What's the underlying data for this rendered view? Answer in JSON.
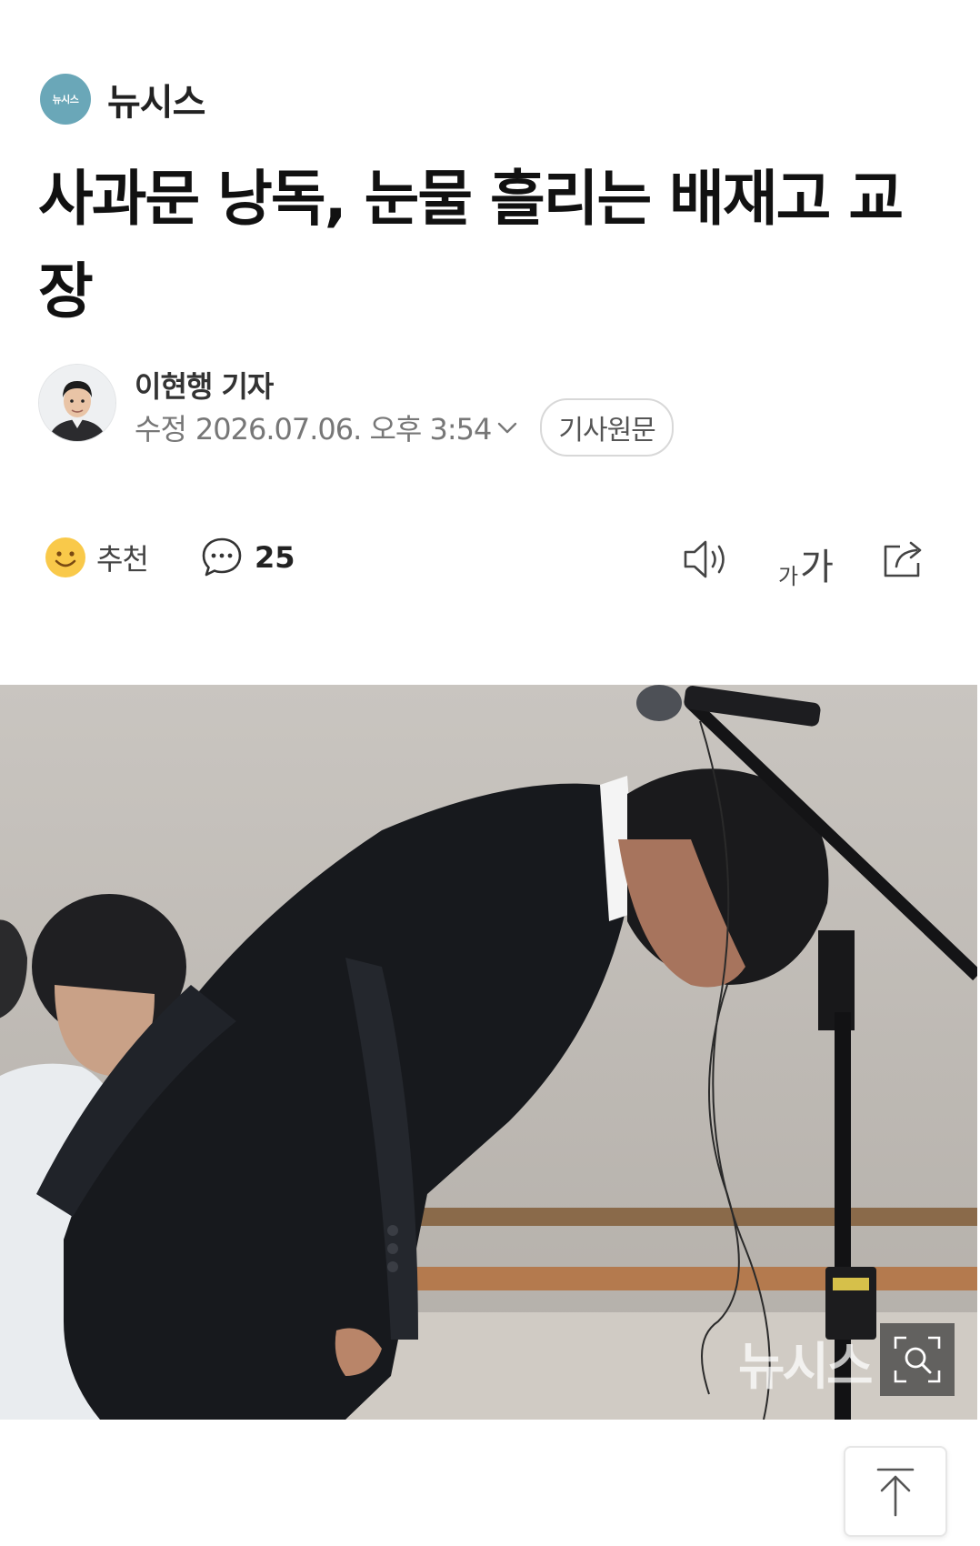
{
  "press": {
    "logo_text": "뉴시스",
    "name": "뉴시스"
  },
  "article": {
    "headline": "사과문 낭독, 눈물 흘리는 배재고 교장"
  },
  "byline": {
    "reporter": "이현행 기자",
    "modified_label": "수정",
    "timestamp": "2026.07.06. 오후 3:54",
    "original_button": "기사원문"
  },
  "actions": {
    "recommend_label": "추천",
    "comment_count": "25",
    "font_small": "가",
    "font_large": "가"
  },
  "photo": {
    "watermark": "뉴시스"
  },
  "icons": [
    "smile-icon",
    "comment-icon",
    "speaker-icon",
    "share-icon",
    "zoom-icon",
    "scroll-top-icon",
    "chevron-down-icon"
  ],
  "colors": {
    "press_logo": "#6aa7b8",
    "smile": "#f9c94a"
  }
}
